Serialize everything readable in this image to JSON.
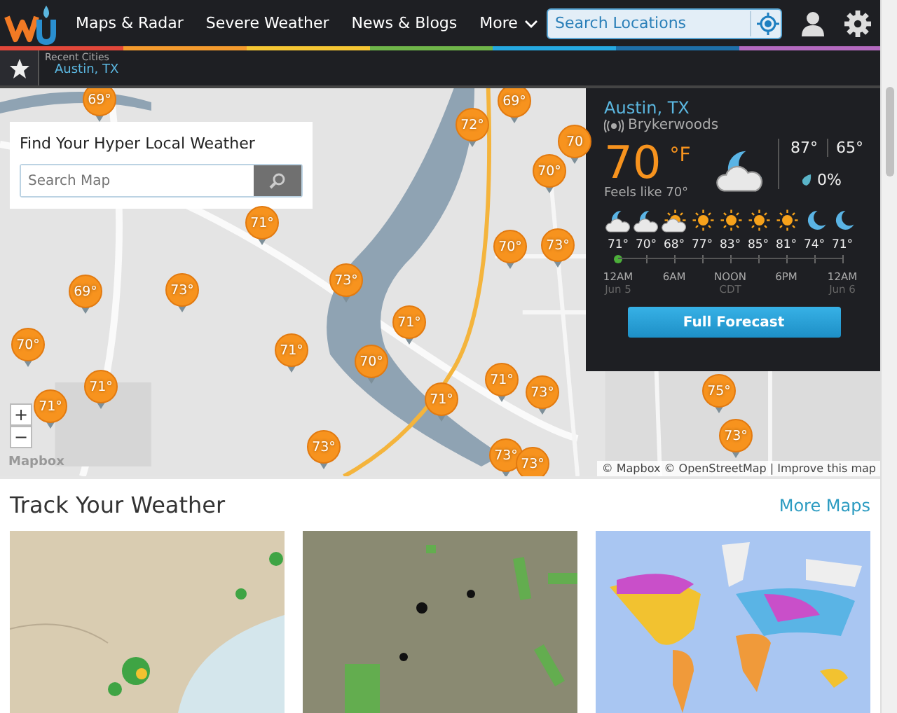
{
  "header": {
    "nav": [
      {
        "label": "Maps & Radar",
        "dropdown": false
      },
      {
        "label": "Severe Weather",
        "dropdown": false
      },
      {
        "label": "News & Blogs",
        "dropdown": false
      },
      {
        "label": "More",
        "dropdown": true
      }
    ],
    "search": {
      "placeholder": "Search Locations"
    }
  },
  "recent": {
    "title": "Recent Cities",
    "cities": [
      "Austin, TX"
    ]
  },
  "map": {
    "search_card": {
      "title": "Find Your Hyper Local Weather",
      "placeholder": "Search Map"
    },
    "pins": [
      {
        "label": "69°"
      },
      {
        "label": "69°"
      },
      {
        "label": "72°"
      },
      {
        "label": "70"
      },
      {
        "label": "70°"
      },
      {
        "label": "71°"
      },
      {
        "label": "70°"
      },
      {
        "label": "73°"
      },
      {
        "label": "69°"
      },
      {
        "label": "73°"
      },
      {
        "label": "73°"
      },
      {
        "label": "71°"
      },
      {
        "label": "70°"
      },
      {
        "label": "71°"
      },
      {
        "label": "70°"
      },
      {
        "label": "71°"
      },
      {
        "label": "71°"
      },
      {
        "label": "71°"
      },
      {
        "label": "71°"
      },
      {
        "label": "73°"
      },
      {
        "label": "73°"
      },
      {
        "label": "73°"
      },
      {
        "label": "73°"
      },
      {
        "label": "75°"
      },
      {
        "label": "73°"
      }
    ],
    "zoom_in": "+",
    "zoom_out": "−",
    "logo": "Mapbox",
    "attribution": "© Mapbox © OpenStreetMap | Improve this map"
  },
  "conditions": {
    "city": "Austin, TX",
    "station": "Brykerwoods",
    "temp": "70",
    "unit": "°F",
    "feels_like": "Feels like 70°",
    "now_icon": {
      "kind": "night-cloudy"
    },
    "high": "87°",
    "low": "65°",
    "precip": "0%",
    "hourly": [
      {
        "kind": "night-cloudy",
        "temp": "71°",
        "current": true
      },
      {
        "kind": "night-cloudy",
        "temp": "70°",
        "current": false
      },
      {
        "kind": "partly-sunny",
        "temp": "68°",
        "current": false
      },
      {
        "kind": "sunny",
        "temp": "77°",
        "current": false
      },
      {
        "kind": "sunny",
        "temp": "83°",
        "current": false
      },
      {
        "kind": "sunny",
        "temp": "85°",
        "current": false
      },
      {
        "kind": "sunny",
        "temp": "81°",
        "current": false
      },
      {
        "kind": "night",
        "temp": "74°",
        "current": false
      },
      {
        "kind": "night",
        "temp": "71°",
        "current": false
      }
    ],
    "axis": [
      {
        "time": "12AM",
        "sub": "Jun 5"
      },
      {
        "time": "6AM"
      },
      {
        "time": "NOON",
        "sub": "CDT"
      },
      {
        "time": "6PM"
      },
      {
        "time": "12AM",
        "sub": "Jun 6"
      }
    ],
    "button": "Full Forecast"
  },
  "section": {
    "title": "Track Your Weather",
    "link": "More Maps",
    "thumbnails": [
      {
        "kind": "radar"
      },
      {
        "kind": "warnings"
      },
      {
        "kind": "world"
      }
    ]
  }
}
